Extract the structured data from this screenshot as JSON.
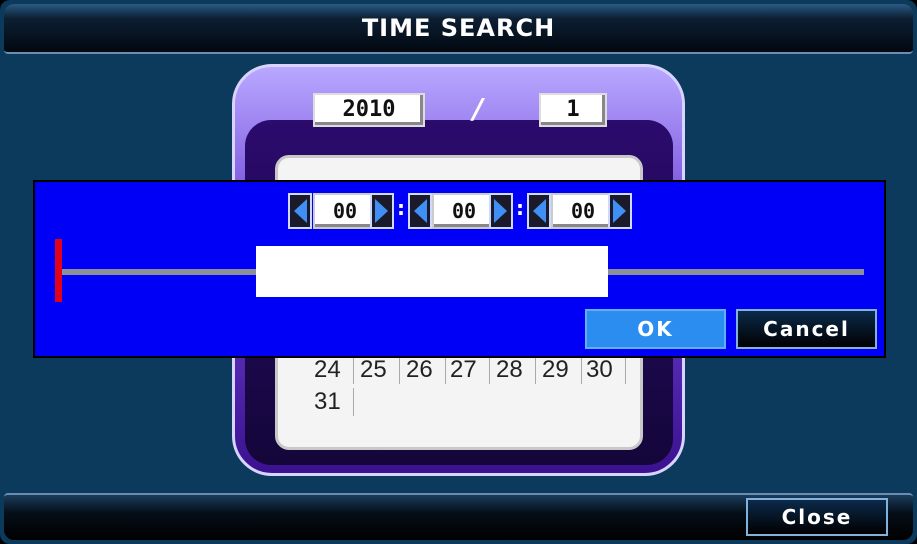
{
  "window": {
    "title": "TIME SEARCH"
  },
  "calendar": {
    "year": "2010",
    "separator": "/",
    "month": "1",
    "visible_days": [
      "24",
      "25",
      "26",
      "27",
      "28",
      "29",
      "30",
      "31"
    ]
  },
  "time_dialog": {
    "hour": "00",
    "minute": "00",
    "second": "00",
    "colon": ":",
    "ok_label": "OK",
    "cancel_label": "Cancel"
  },
  "footer": {
    "close_label": "Close"
  },
  "colors": {
    "dialog_bg": "#0000f6",
    "ok_button": "#2c8df0",
    "timeline_marker": "#e0001a",
    "calendar_accent": "#6f43d6"
  }
}
